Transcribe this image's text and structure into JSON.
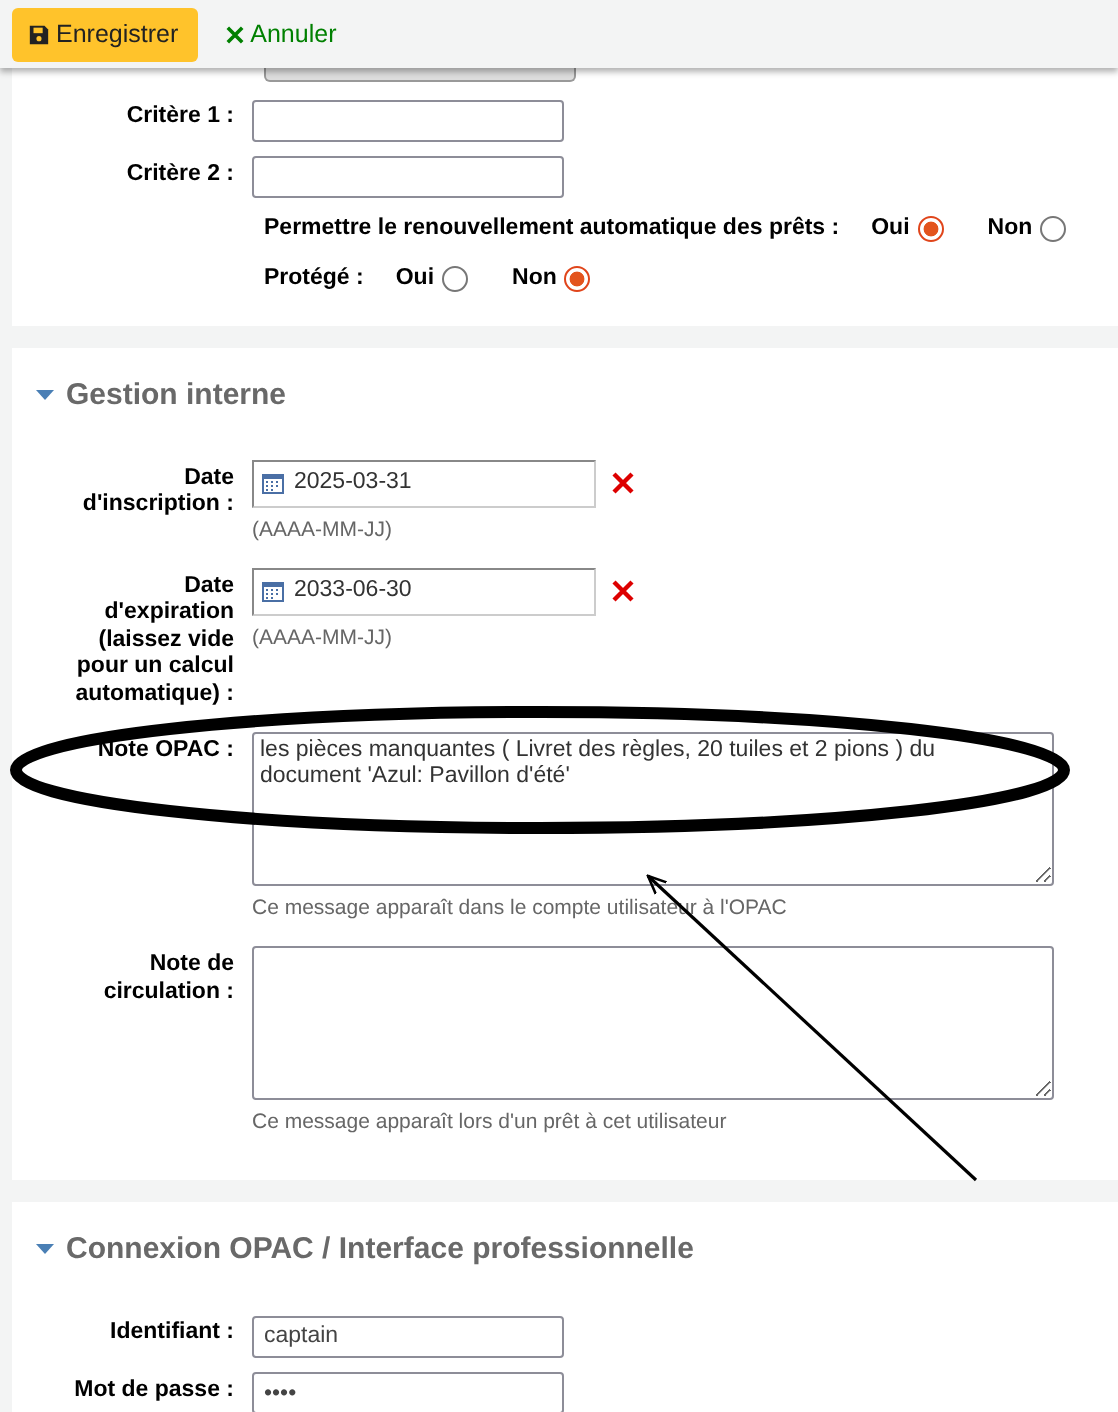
{
  "toolbar": {
    "buttons": [
      {
        "kind": "save",
        "label": "Enregistrer"
      },
      {
        "kind": "cancel",
        "label": "Annuler"
      }
    ]
  },
  "sections": [
    {
      "fields": [
        {
          "kind": "select"
        },
        {
          "kind": "text",
          "label": "Critère 1 :"
        },
        {
          "kind": "text",
          "label": "Critère 2 :"
        },
        {
          "kind": "radio",
          "label": "Permettre le renouvellement automatique des prêts :",
          "options": [
            {
              "label": "Oui",
              "selected": true
            },
            {
              "label": "Non",
              "selected": false
            }
          ]
        },
        {
          "kind": "radio",
          "label": "Protégé :",
          "options": [
            {
              "label": "Oui",
              "selected": false
            },
            {
              "label": "Non",
              "selected": true
            }
          ]
        }
      ]
    },
    {
      "title": "Gestion interne",
      "fields": [
        {
          "kind": "date",
          "label": "Date d'inscription :",
          "value": "2025-03-31",
          "hint": "(AAAA-MM-JJ)"
        },
        {
          "kind": "date",
          "label": "Date d'expiration (laissez vide pour un calcul automatique) :",
          "value": "2033-06-30",
          "hint": "(AAAA-MM-JJ)"
        },
        {
          "kind": "textarea",
          "label": "Note OPAC :",
          "value": "les pièces manquantes ( Livret des règles, 20 tuiles et 2 pions ) du document 'Azul: Pavillon d'été'",
          "hint": "Ce message apparaît dans le compte utilisateur à l'OPAC"
        },
        {
          "kind": "textarea",
          "label": "Note de circulation :",
          "hint": "Ce message apparaît lors d'un prêt à cet utilisateur"
        }
      ]
    },
    {
      "title": "Connexion OPAC / Interface professionnelle",
      "fields": [
        {
          "kind": "text",
          "label": "Identifiant :",
          "value": "captain"
        },
        {
          "kind": "password",
          "label": "Mot de passe :",
          "value": "••••"
        }
      ]
    }
  ]
}
